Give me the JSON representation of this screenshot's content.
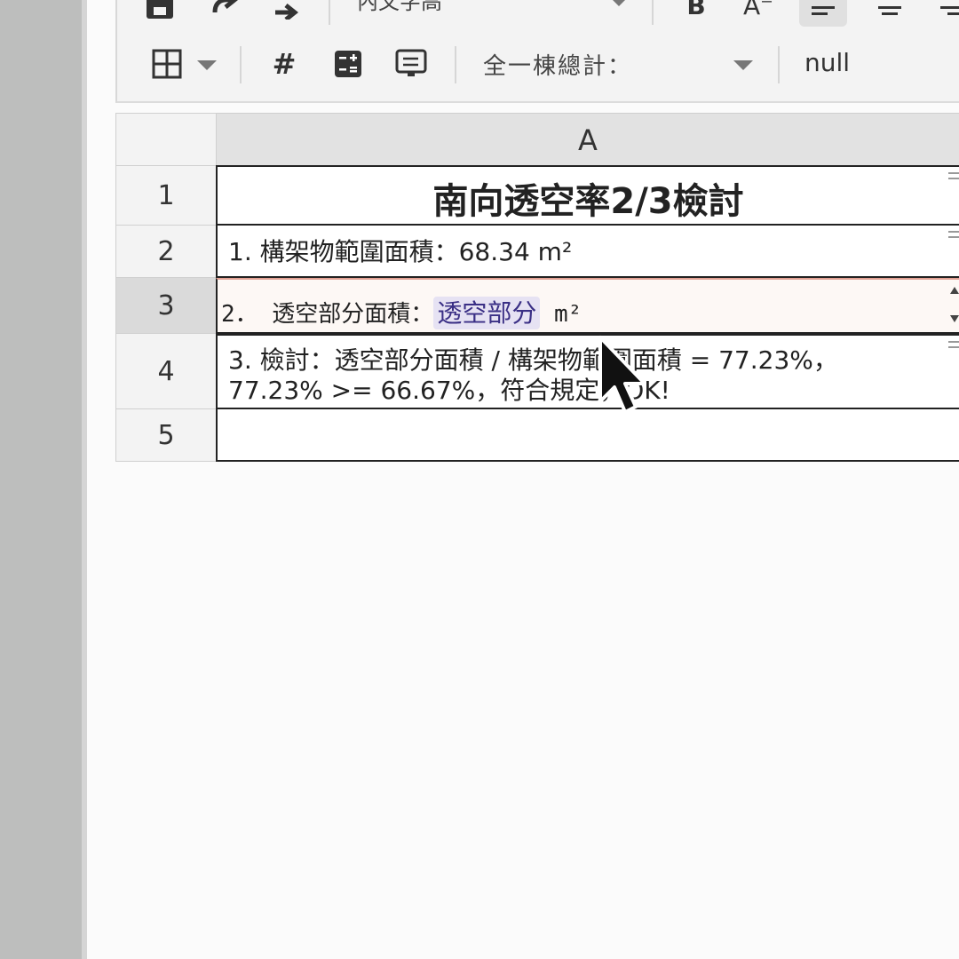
{
  "toolbar": {
    "row1": {
      "save_icon": "save-icon",
      "undo_icon": "undo-icon",
      "redo_icon": "redo-icon",
      "font_select_value": "內文字高",
      "bold_label": "B",
      "decrease_font_label": "A⁻",
      "align_left_icon": "align-left-icon",
      "align_center_icon": "align-center-icon",
      "align_right_icon": "align-right-icon"
    },
    "row2": {
      "borders_icon": "grid-borders-icon",
      "hash_label": "#",
      "calculator_icon": "calculator-icon",
      "display_icon": "display-icon",
      "picker_label": "全一棟總計：",
      "value_display": "null"
    }
  },
  "sheet": {
    "column_header": "A",
    "rows": [
      {
        "num": "1",
        "text": "南向透空率2/3檢討"
      },
      {
        "num": "2",
        "text": "1. 構架物範圍面積：68.34 m²"
      },
      {
        "num": "3",
        "prefix": "2． 透空部分面積：",
        "chip": "透空部分",
        "suffix": " m²"
      },
      {
        "num": "4",
        "line1": "3. 檢討：透空部分面積 / 構架物範圍面積 = 77.23%，",
        "line2": "77.23% >= 66.67%，符合規定，OK!"
      },
      {
        "num": "5",
        "text": ""
      }
    ]
  },
  "colors": {
    "active_row_border": "#e3a295",
    "chip_background": "#e6e2f3",
    "chip_text": "#3a2f85"
  }
}
